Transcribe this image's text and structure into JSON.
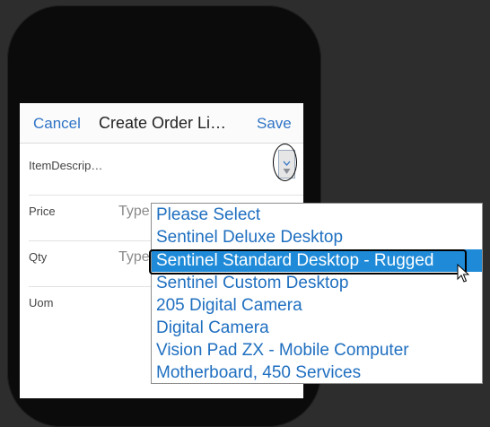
{
  "form": {
    "header": {
      "cancel": "Cancel",
      "title": "Create Order Li…",
      "save": "Save"
    },
    "fields": {
      "item_description": {
        "label": "ItemDescrip…"
      },
      "price": {
        "label": "Price",
        "placeholder": "Type"
      },
      "qty": {
        "label": "Qty",
        "placeholder": "Type"
      },
      "uom": {
        "label": "Uom"
      }
    }
  },
  "dropdown": {
    "options": [
      "Please Select",
      "Sentinel Deluxe Desktop",
      "Sentinel Standard Desktop - Rugged",
      "Sentinel Custom Desktop",
      "205 Digital Camera",
      "Digital Camera",
      "Vision Pad ZX - Mobile Computer",
      "Motherboard, 450 Services"
    ],
    "highlighted": "Sentinel Standard Desktop - Rugged"
  },
  "icons": {
    "select_arrow": "chevron-down-icon",
    "pointer": "mouse-pointer-icon"
  },
  "colors": {
    "link_blue": "#2f74c6",
    "option_blue": "#1f6fc0",
    "highlight_blue": "#1e8ad8",
    "background_dark": "#2d2d2d"
  }
}
